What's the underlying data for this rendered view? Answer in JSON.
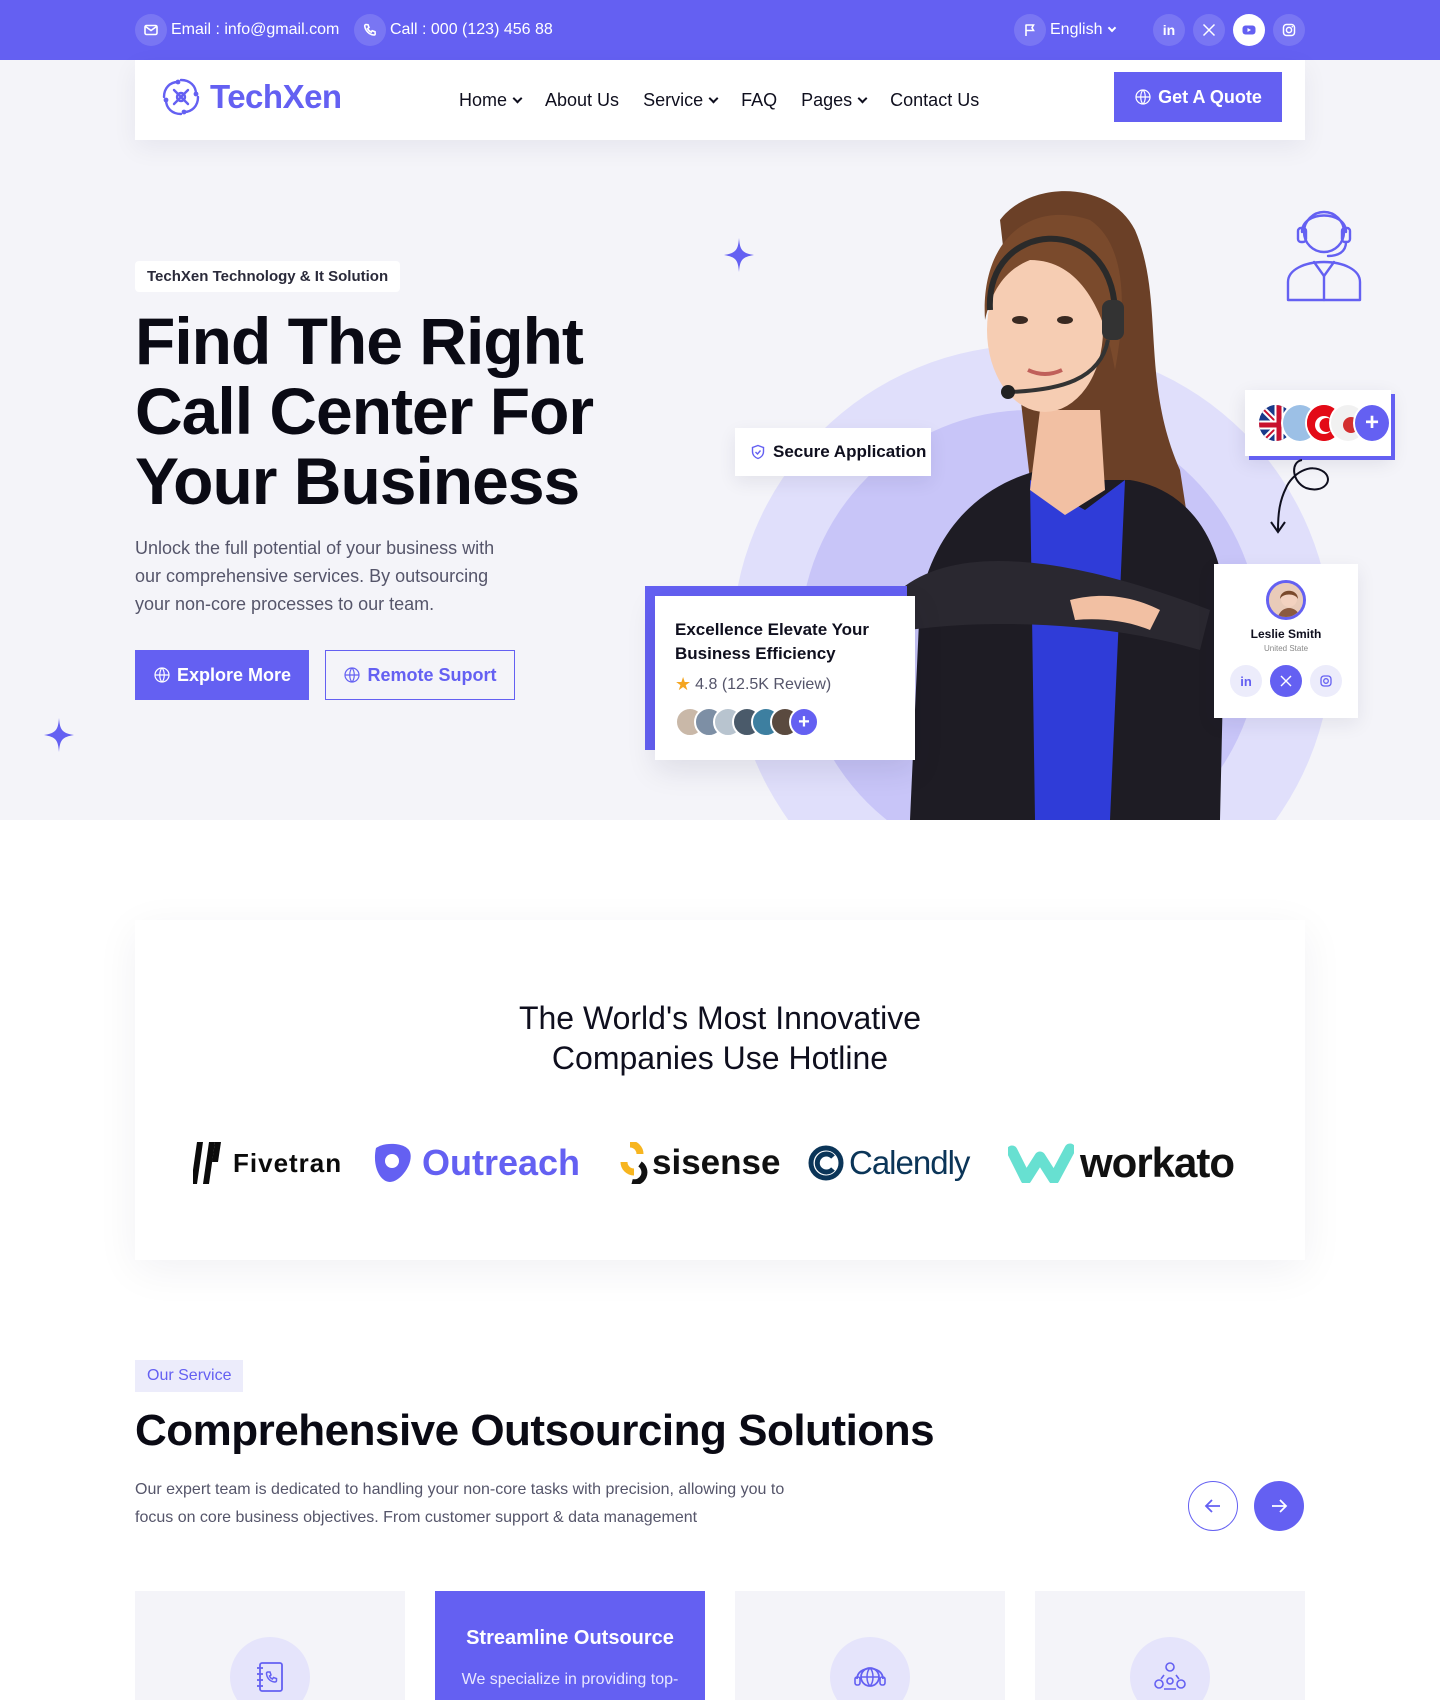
{
  "topbar": {
    "email": "Email : info@gmail.com",
    "call": "Call : 000 (123) 456 88",
    "language": "English",
    "socials": [
      "linkedin-icon",
      "x-icon",
      "youtube-icon",
      "instagram-icon"
    ],
    "social_linkedin_label": "in"
  },
  "nav": {
    "logo_text": "TechXen",
    "menu": [
      {
        "label": "Home",
        "dropdown": true
      },
      {
        "label": "About Us",
        "dropdown": false
      },
      {
        "label": "Service",
        "dropdown": true
      },
      {
        "label": "FAQ",
        "dropdown": false
      },
      {
        "label": "Pages",
        "dropdown": true
      },
      {
        "label": "Contact Us",
        "dropdown": false
      }
    ],
    "cta_label": "Get A Quote"
  },
  "hero": {
    "tagline": "TechXen Technology & It Solution",
    "title": "Find The  Right Call Center For Your Business",
    "description": "Unlock the full potential of your business with our comprehensive services. By outsourcing your non-core processes to our team.",
    "primary_button": "Explore More",
    "secondary_button": "Remote Suport",
    "secure_label": "Secure Application",
    "card_title": "Excellence Elevate Your Business Efficiency",
    "card_rating": "4.8 (12.5K Review)",
    "card_plus": "+",
    "flags_plus": "+",
    "person_name": "Leslie Smith",
    "person_location": "United State",
    "person_linkedin": "in"
  },
  "brands": {
    "title_line1": "The World's Most Innovative",
    "title_line2": "Companies Use Hotline",
    "logos": [
      "Fivetran",
      "Outreach",
      "sisense",
      "Calendly",
      "workato"
    ]
  },
  "services": {
    "badge": "Our Service",
    "title": "Comprehensive Outsourcing Solutions",
    "description": "Our expert team is dedicated to handling your non-core tasks with precision, allowing you to focus on core business objectives. From customer support & data management",
    "cards": [
      {
        "icon": "phone-book-icon"
      },
      {
        "title": "Streamline Outsource",
        "text": "We specialize in providing top-"
      },
      {
        "icon": "globe-headset-icon"
      },
      {
        "icon": "team-support-icon"
      }
    ]
  },
  "colors": {
    "accent": "#6460f2",
    "hero_bg": "#f4f4f9",
    "dark_text": "#0f0f1e"
  }
}
